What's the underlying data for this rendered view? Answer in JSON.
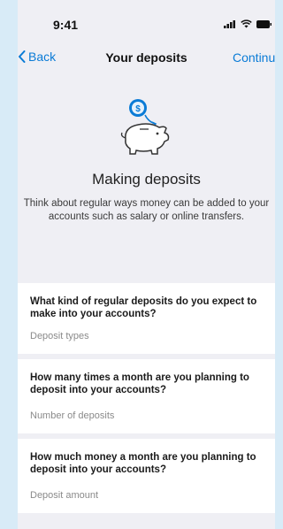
{
  "status": {
    "time": "9:41"
  },
  "nav": {
    "back_label": "Back",
    "title": "Your deposits",
    "continue_label": "Continue"
  },
  "hero": {
    "title": "Making deposits",
    "description": "Think about regular ways money can be added to your accounts such as salary or online transfers."
  },
  "questions": [
    {
      "text": "What kind of regular deposits do you expect to make into your accounts?",
      "placeholder": "Deposit types"
    },
    {
      "text": "How many times a month are you planning to deposit into your accounts?",
      "placeholder": "Number of deposits"
    },
    {
      "text": "How much money a month are you planning to deposit into your accounts?",
      "placeholder": "Deposit amount"
    }
  ],
  "colors": {
    "accent": "#0a7bd6",
    "background": "#efeff4",
    "page_bg": "#d8ebf7"
  },
  "icons": [
    "signal-icon",
    "wifi-icon",
    "battery-icon",
    "chevron-left-icon",
    "piggy-bank-icon",
    "coin-icon"
  ]
}
